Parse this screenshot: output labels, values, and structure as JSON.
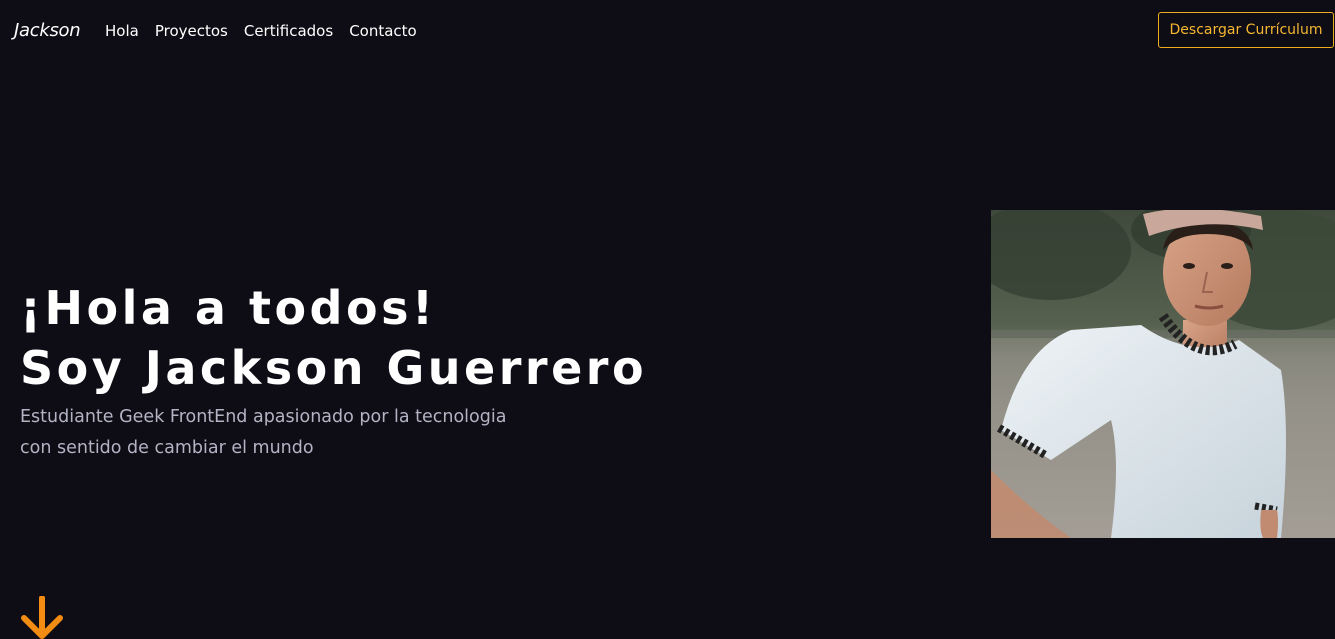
{
  "navbar": {
    "brand": "Jackson",
    "links": [
      "Hola",
      "Proyectos",
      "Certificados",
      "Contacto"
    ],
    "cv_button": "Descargar Currículum"
  },
  "hero": {
    "title_line1": "¡Hola a todos!",
    "title_line2": "Soy Jackson Guerrero",
    "subtitle_line1": "Estudiante Geek FrontEnd apasionado por la tecnologia",
    "subtitle_line2": "con sentido de cambiar el mundo"
  },
  "icons": {
    "scroll_down": "arrow-down-icon"
  },
  "colors": {
    "background": "#0e0d15",
    "accent": "#f5b731",
    "arrow": "#f28c12",
    "subtitle": "#b3b3c4"
  }
}
